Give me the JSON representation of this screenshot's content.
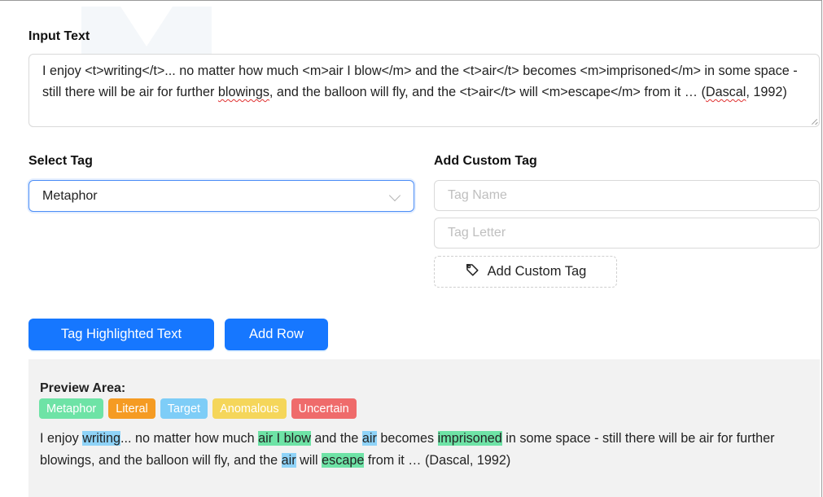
{
  "input_section": {
    "label": "Input Text",
    "text_segments": [
      {
        "text": "I enjoy <t>writing</t>... no matter how much <m>air I blow</m> and the <t>air</t> becomes <m>imprisoned</m> in some space - still there will be air for further ",
        "squiggle": false
      },
      {
        "text": "blowings",
        "squiggle": true
      },
      {
        "text": ", and the balloon will fly, and the <t>air</t> will <m>escape</m> from it … (",
        "squiggle": false
      },
      {
        "text": "Dascal",
        "squiggle": true
      },
      {
        "text": ", 1992)",
        "squiggle": false
      }
    ]
  },
  "select_tag": {
    "label": "Select Tag",
    "selected": "Metaphor"
  },
  "custom_tag": {
    "label": "Add Custom Tag",
    "name_placeholder": "Tag Name",
    "letter_placeholder": "Tag Letter",
    "add_button_label": "Add Custom Tag",
    "add_button_icon": "tag-icon"
  },
  "actions": {
    "tag_highlighted_label": "Tag Highlighted Text",
    "add_row_label": "Add Row",
    "primary_color": "#1677ff"
  },
  "preview": {
    "title": "Preview Area:",
    "legend": [
      {
        "label": "Metaphor",
        "color": "#6ee3a6"
      },
      {
        "label": "Literal",
        "color": "#f59b23"
      },
      {
        "label": "Target",
        "color": "#7ecdf7"
      },
      {
        "label": "Anomalous",
        "color": "#f5d65a"
      },
      {
        "label": "Uncertain",
        "color": "#ef6b6b"
      }
    ],
    "segments": [
      {
        "text": "I enjoy ",
        "tag": ""
      },
      {
        "text": "writing",
        "tag": "t"
      },
      {
        "text": "... no matter how much ",
        "tag": ""
      },
      {
        "text": "air I blow",
        "tag": "m"
      },
      {
        "text": " and the ",
        "tag": ""
      },
      {
        "text": "air",
        "tag": "t"
      },
      {
        "text": " becomes ",
        "tag": ""
      },
      {
        "text": "imprisoned",
        "tag": "m"
      },
      {
        "text": " in some space - still there will be air for further blowings, and the balloon will fly, and the ",
        "tag": ""
      },
      {
        "text": "air",
        "tag": "t"
      },
      {
        "text": " will ",
        "tag": ""
      },
      {
        "text": "escape",
        "tag": "m"
      },
      {
        "text": " from it … (Dascal, 1992)",
        "tag": ""
      }
    ]
  }
}
